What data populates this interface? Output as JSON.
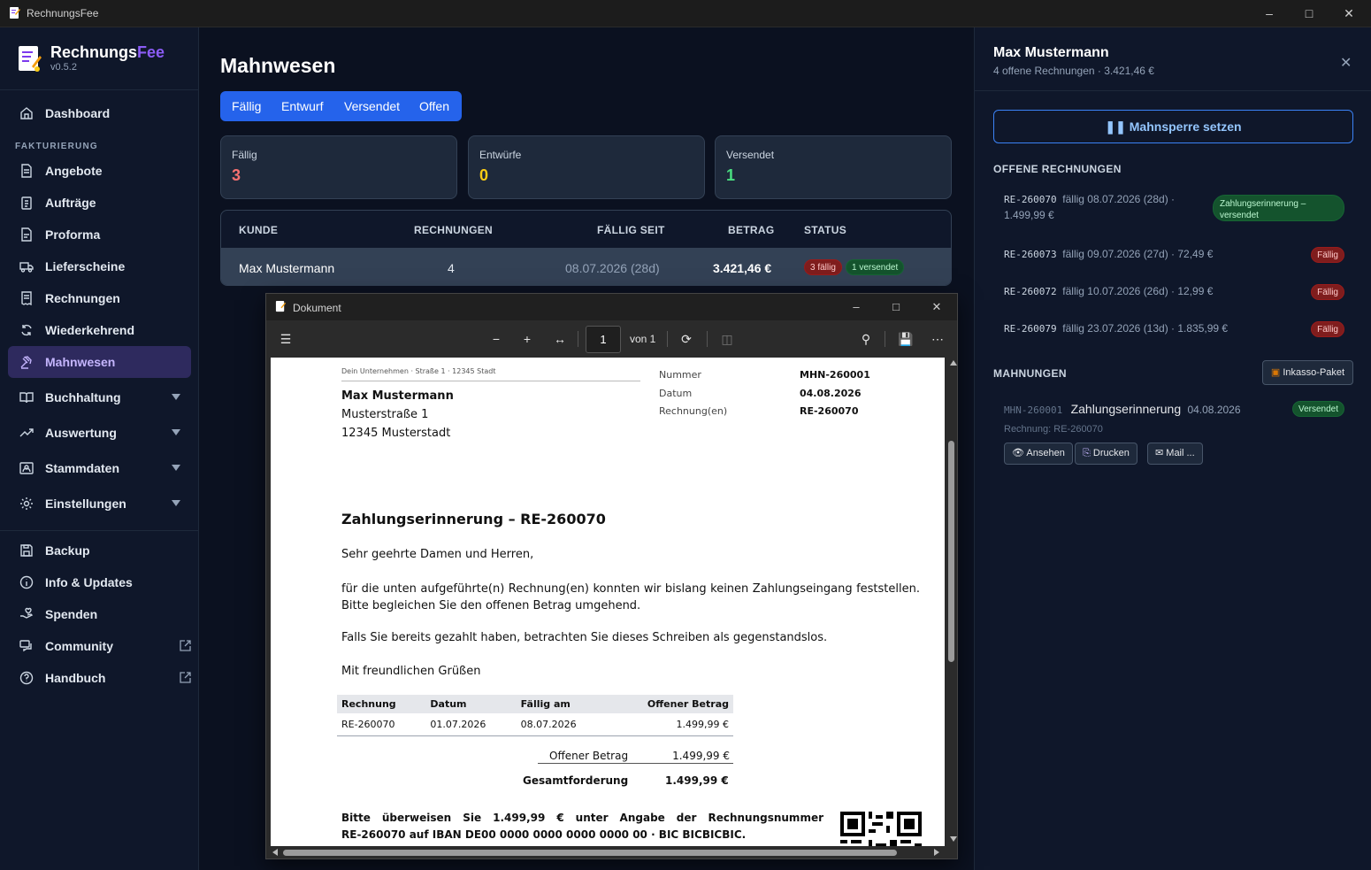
{
  "window": {
    "title": "RechnungsFee"
  },
  "brand": {
    "name_main": "Rechnungs",
    "name_accent": "Fee",
    "version": "v0.5.2"
  },
  "sidebar": {
    "dashboard": "Dashboard",
    "section_fakturierung": "FAKTURIERUNG",
    "items": [
      "Angebote",
      "Aufträge",
      "Proforma",
      "Lieferscheine",
      "Rechnungen",
      "Wiederkehrend",
      "Mahnwesen"
    ],
    "groups": [
      "Buchhaltung",
      "Auswertung",
      "Stammdaten",
      "Einstellungen"
    ],
    "bottom": [
      "Backup",
      "Info & Updates",
      "Spenden",
      "Community",
      "Handbuch"
    ]
  },
  "main": {
    "title": "Mahnwesen",
    "tabs": [
      "Fällig",
      "Entwurf",
      "Versendet",
      "Offen"
    ],
    "kpis": [
      {
        "label": "Fällig",
        "value": "3",
        "color": "#f87171"
      },
      {
        "label": "Entwürfe",
        "value": "0",
        "color": "#facc15"
      },
      {
        "label": "Versendet",
        "value": "1",
        "color": "#4ade80"
      }
    ],
    "table": {
      "headers": [
        "KUNDE",
        "RECHNUNGEN",
        "FÄLLIG SEIT",
        "BETRAG",
        "STATUS"
      ],
      "row": {
        "kunde": "Max Mustermann",
        "rechnungen": "4",
        "faellig_seit": "08.07.2026 (28d)",
        "betrag": "3.421,46 €",
        "badge_due": "3 fällig",
        "badge_sent": "1 versendet"
      }
    }
  },
  "panel": {
    "name": "Max Mustermann",
    "subtitle": "4 offene Rechnungen · 3.421,46 €",
    "mahnsperre": "Mahnsperre setzen",
    "open_heading": "OFFENE RECHNUNGEN",
    "invoices": [
      {
        "num": "RE-260070",
        "text1": "fällig 08.07.2026 (28d) ·",
        "text2": "1.499,99 €",
        "badge": "Zahlungserinnerung – versendet"
      },
      {
        "num": "RE-260073",
        "text1": "fällig 09.07.2026 (27d) · 72,49 €",
        "badge": "Fällig"
      },
      {
        "num": "RE-260072",
        "text1": "fällig 10.07.2026 (26d) · 12,99 €",
        "badge": "Fällig"
      },
      {
        "num": "RE-260079",
        "text1": "fällig 23.07.2026 (13d) · 1.835,99 €",
        "badge": "Fällig"
      }
    ],
    "mahn_heading": "MAHNUNGEN",
    "inkasso": "Inkasso-Paket",
    "mahnung": {
      "num": "MHN-260001",
      "title": "Zahlungserinnerung",
      "date": "04.08.2026",
      "badge": "Versendet",
      "ref": "Rechnung: RE-260070"
    },
    "actions": [
      "Ansehen",
      "Drucken",
      "Mail ..."
    ]
  },
  "doc": {
    "window_title": "Dokument",
    "page": "1",
    "of": "von 1",
    "sender": "Dein Unternehmen · Straße 1 · 12345 Stadt",
    "recipient": [
      "Max Mustermann",
      "Musterstraße 1",
      "12345 Musterstadt"
    ],
    "meta": [
      {
        "k": "Nummer",
        "v": "MHN-260001"
      },
      {
        "k": "Datum",
        "v": "04.08.2026"
      },
      {
        "k": "Rechnung(en)",
        "v": "RE-260070"
      }
    ],
    "heading": "Zahlungserinnerung – RE-260070",
    "salutation": "Sehr geehrte Damen und Herren,",
    "body1": "für die unten aufgeführte(n) Rechnung(en) konnten wir bislang keinen Zahlungseingang feststellen. Bitte begleichen Sie den offenen Betrag umgehend.",
    "body2": "Falls Sie bereits gezahlt haben, betrachten Sie dieses Schreiben als gegenstandslos.",
    "closing": "Mit freundlichen Grüßen",
    "table_headers": [
      "Rechnung",
      "Datum",
      "Fällig am",
      "Offener Betrag"
    ],
    "table_row": [
      "RE-260070",
      "01.07.2026",
      "08.07.2026",
      "1.499,99 €"
    ],
    "sum_open_label": "Offener Betrag",
    "sum_open": "1.499,99 €",
    "sum_total_label": "Gesamtforderung",
    "sum_total": "1.499,99 €",
    "pay_line1": "Bitte überweisen Sie 1.499,99 € unter Angabe der Rechnungsnummer",
    "pay_line2": "RE-260070 auf IBAN DE00 0000 0000 0000 0000 00 · BIC BICBICBIC."
  }
}
